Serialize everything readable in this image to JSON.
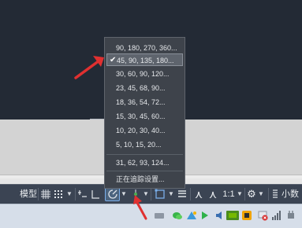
{
  "status_bar": {
    "model_label": "模型",
    "scale_label": "1:1",
    "annotation_scale_label": "小数"
  },
  "polar_tracking_menu": {
    "selected_index": 1,
    "items": [
      "90, 180, 270, 360...",
      "45, 90, 135, 180...",
      "30, 60, 90, 120...",
      "23, 45, 68, 90...",
      "18, 36, 54, 72...",
      "15, 30, 45, 60...",
      "10, 20, 30, 40...",
      "5, 10, 15, 20..."
    ],
    "extra_item": "31, 62, 93, 124...",
    "settings_item": "正在追踪设置..."
  },
  "colors": {
    "canvas": "#232a35",
    "menu_background": "#3e434b",
    "highlight": "#5e646d",
    "accent_blue": "#7aaee9",
    "pointer_red": "#e03030"
  }
}
